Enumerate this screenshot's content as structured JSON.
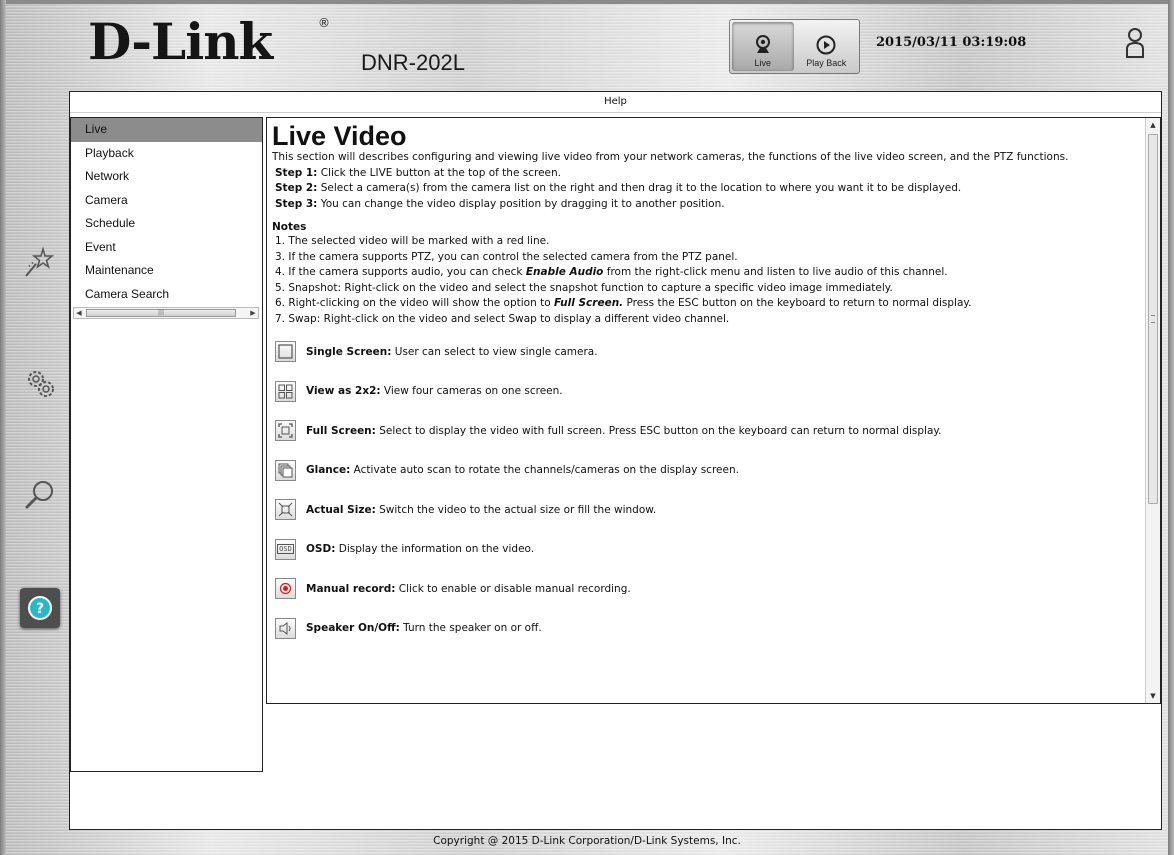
{
  "header": {
    "logo_text": "D-Link",
    "model": "DNR-202L",
    "datetime": "2015/03/11 03:19:08",
    "modes": [
      {
        "label": "Live",
        "icon": "webcam-icon"
      },
      {
        "label": "Play Back",
        "icon": "play-circle-icon"
      }
    ]
  },
  "dock": [
    {
      "name": "wizard-icon"
    },
    {
      "name": "settings-icon"
    },
    {
      "name": "search-icon"
    },
    {
      "name": "help-icon"
    }
  ],
  "help_window": {
    "title": "Help",
    "nav_items": [
      "Live",
      "Playback",
      "Network",
      "Camera",
      "Schedule",
      "Event",
      "Maintenance",
      "Camera Search"
    ],
    "selected_nav": "Live",
    "content": {
      "heading": "Live Video",
      "intro": "This section will describes configuring and viewing live video from your network cameras, the functions of the live video screen, and the PTZ functions.",
      "steps": [
        {
          "label": "Step 1:",
          "text": " Click the LIVE button at the top of the screen."
        },
        {
          "label": "Step 2:",
          "text": " Select a camera(s) from the camera list on the right and then drag it to the location to where you want it to be displayed."
        },
        {
          "label": "Step 3:",
          "text": " You can change the video display position by dragging it to another position."
        }
      ],
      "notes_title": "Notes",
      "note1": "1. The selected video will be marked with a red line.",
      "note3": "3. If the camera supports PTZ, you can control the selected camera from the PTZ panel.",
      "note4_pre": "4. If the camera supports audio, you can check ",
      "note4_bold": "Enable Audio",
      "note4_post": " from the right-click menu and listen to live audio of this channel.",
      "note5": "5. Snapshot: Right-click on the video and select the snapshot function to capture a specific video image immediately.",
      "note6_pre": "6. Right-clicking on the video will show the option to ",
      "note6_bold": "Full Screen.",
      "note6_post": " Press the ESC button on the keyboard to return to normal display.",
      "note7": "7. Swap: Right-click on the video and select Swap to display a different video channel.",
      "features": [
        {
          "label": "Single Screen:",
          "desc": " User can select to view single camera."
        },
        {
          "label": "View as 2x2:",
          "desc": " View four cameras on one screen."
        },
        {
          "label": "Full Screen:",
          "desc": " Select to display the video with full screen. Press ESC button on the keyboard can return to normal display."
        },
        {
          "label": "Glance:",
          "desc": " Activate auto scan to rotate the channels/cameras on the display screen."
        },
        {
          "label": "Actual Size:",
          "desc": " Switch the video to the actual size or fill the window."
        },
        {
          "label": "OSD:",
          "desc": " Display the information on the video."
        },
        {
          "label": "Manual record:",
          "desc": " Click to enable or disable manual recording."
        },
        {
          "label": "Speaker On/Off:",
          "desc": " Turn the speaker on or off."
        }
      ],
      "osd_icon_text": "OSD"
    }
  },
  "footer": "Copyright @ 2015 D-Link Corporation/D-Link Systems, Inc."
}
